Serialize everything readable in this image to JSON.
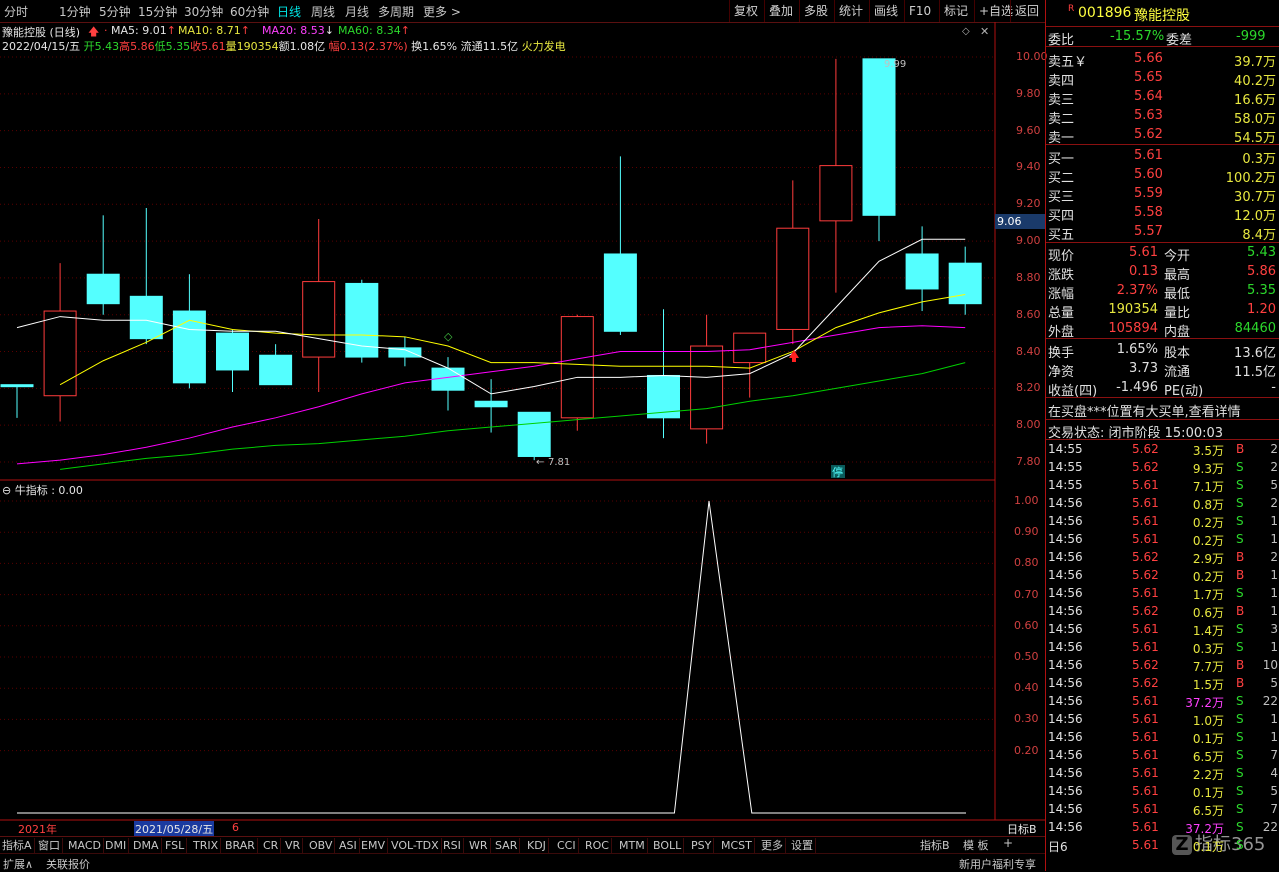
{
  "toolbar": {
    "tabs": [
      "分时",
      "1分钟",
      "5分钟",
      "15分钟",
      "30分钟",
      "60分钟",
      "日线",
      "周线",
      "月线",
      "多周期",
      "更多 >"
    ],
    "active": "日线",
    "right_buttons": [
      "复权",
      "叠加",
      "多股",
      "统计",
      "画线",
      "F10",
      "标记",
      "+自选",
      "返回"
    ]
  },
  "chart_title": {
    "name": "豫能控股 (日线)",
    "ma5": "MA5: 9.01",
    "ma10": "MA10: 8.71",
    "ma20": "MA20: 8.53",
    "ma60": "MA60: 8.34",
    "date": "2022/04/15/五",
    "open": "开5.43",
    "high": "高5.86",
    "low": "低5.35",
    "close": "收5.61",
    "vol": "量190354",
    "amt": "额1.08亿",
    "chg": "幅0.13(2.37%)",
    "turnover": "换1.65%",
    "float": "流通11.5亿",
    "concept": "火力发电"
  },
  "price_axis": [
    "10.00",
    "9.80",
    "9.60",
    "9.40",
    "9.20",
    "9.00",
    "8.80",
    "8.60",
    "8.40",
    "8.20",
    "8.00",
    "7.80"
  ],
  "price_marker": "9.06",
  "chart_labels": {
    "high_note": "9.99",
    "low_note": "7.81",
    "stop_badge": "停"
  },
  "chart_data": [
    {
      "type": "candlestick",
      "ylim": [
        7.72,
        10.1
      ],
      "candles": [
        {
          "o": 8.22,
          "c": 8.22,
          "h": 8.22,
          "l": 8.04
        },
        {
          "o": 8.16,
          "c": 8.62,
          "h": 8.88,
          "l": 8.02
        },
        {
          "o": 8.82,
          "c": 8.66,
          "h": 9.14,
          "l": 8.6
        },
        {
          "o": 8.7,
          "c": 8.47,
          "h": 9.18,
          "l": 8.44
        },
        {
          "o": 8.62,
          "c": 8.23,
          "h": 8.82,
          "l": 8.2
        },
        {
          "o": 8.5,
          "c": 8.3,
          "h": 8.52,
          "l": 8.18
        },
        {
          "o": 8.38,
          "c": 8.22,
          "h": 8.44,
          "l": 8.22
        },
        {
          "o": 8.37,
          "c": 8.78,
          "h": 9.12,
          "l": 8.18
        },
        {
          "o": 8.77,
          "c": 8.37,
          "h": 8.79,
          "l": 8.34
        },
        {
          "o": 8.42,
          "c": 8.37,
          "h": 8.48,
          "l": 8.32
        },
        {
          "o": 8.31,
          "c": 8.19,
          "h": 8.37,
          "l": 8.08
        },
        {
          "o": 8.13,
          "c": 8.1,
          "h": 8.25,
          "l": 7.96
        },
        {
          "o": 8.07,
          "c": 7.83,
          "h": 8.07,
          "l": 7.81
        },
        {
          "o": 8.04,
          "c": 8.59,
          "h": 8.6,
          "l": 7.97
        },
        {
          "o": 8.93,
          "c": 8.51,
          "h": 9.46,
          "l": 8.49
        },
        {
          "o": 8.27,
          "c": 8.04,
          "h": 8.63,
          "l": 7.93
        },
        {
          "o": 7.98,
          "c": 8.43,
          "h": 8.6,
          "l": 7.9
        },
        {
          "o": 8.34,
          "c": 8.5,
          "h": 8.5,
          "l": 8.15
        },
        {
          "o": 8.52,
          "c": 9.07,
          "h": 9.33,
          "l": 8.44
        },
        {
          "o": 9.11,
          "c": 9.41,
          "h": 9.99,
          "l": 8.72
        },
        {
          "o": 9.99,
          "c": 9.14,
          "h": 9.99,
          "l": 9.0
        },
        {
          "o": 8.93,
          "c": 8.74,
          "h": 9.08,
          "l": 8.62
        },
        {
          "o": 8.88,
          "c": 8.66,
          "h": 8.97,
          "l": 8.6
        }
      ],
      "ma5": [
        8.53,
        8.59,
        8.57,
        8.57,
        8.52,
        8.51,
        8.51,
        8.47,
        8.43,
        8.41,
        8.31,
        8.17,
        8.21,
        8.26,
        8.26,
        8.27,
        8.26,
        8.28,
        8.39,
        8.64,
        8.89,
        9.01,
        9.01
      ],
      "ma10": [
        null,
        8.22,
        8.35,
        8.45,
        8.57,
        8.52,
        8.5,
        8.49,
        8.49,
        8.48,
        8.43,
        8.34,
        8.34,
        8.33,
        8.32,
        8.32,
        8.32,
        8.31,
        8.4,
        8.53,
        8.61,
        8.67,
        8.71
      ],
      "ma20": [
        7.79,
        7.81,
        7.84,
        7.88,
        7.93,
        7.99,
        8.04,
        8.1,
        8.17,
        8.23,
        8.26,
        8.29,
        8.32,
        8.36,
        8.4,
        8.4,
        8.4,
        8.41,
        8.45,
        8.49,
        8.53,
        8.54,
        8.53
      ],
      "ma60": [
        null,
        7.76,
        7.79,
        7.82,
        7.84,
        7.87,
        7.89,
        7.9,
        7.92,
        7.94,
        7.97,
        7.99,
        8.01,
        8.03,
        8.05,
        8.07,
        8.09,
        8.13,
        8.16,
        8.2,
        8.24,
        8.28,
        8.34
      ]
    },
    {
      "type": "line",
      "title": "牛指标 : 0.00",
      "ylim": [
        0,
        1.0
      ],
      "values": [
        0,
        0,
        0,
        0,
        0,
        0,
        0,
        0,
        0,
        0,
        0,
        0,
        0,
        0,
        0,
        0,
        0,
        0,
        0,
        0,
        1,
        0,
        0,
        0,
        0,
        0,
        0
      ]
    }
  ],
  "sub_title": "牛指标 : 0.00",
  "sub_axis": [
    "1.00",
    "0.90",
    "0.80",
    "0.70",
    "0.60",
    "0.50",
    "0.40",
    "0.30",
    "0.20"
  ],
  "sub_right_label": "日标B",
  "time_axis": {
    "year": "2021年",
    "cursor_date": "2021/05/28/五",
    "six": "6"
  },
  "indicator_tabs": [
    "指标A",
    "窗口",
    "MACD",
    "DMI",
    "DMA",
    "FSL",
    "TRIX",
    "BRAR",
    "CR",
    "VR",
    "OBV",
    "ASI",
    "EMV",
    "VOL-TDX",
    "RSI",
    "WR",
    "SAR",
    "KDJ",
    "CCI",
    "ROC",
    "MTM",
    "BOLL",
    "PSY",
    "MCST",
    "更多",
    "设置"
  ],
  "indicator_right": [
    "指标B",
    "模 板",
    "+"
  ],
  "status_left": [
    "扩展∧",
    "关联报价"
  ],
  "status_right": "新用户福利专享",
  "quote": {
    "badge": "R",
    "code": "001896",
    "name": "豫能控股",
    "webi_label": "委比",
    "webi": "-15.57%",
    "weicha_label": "委差",
    "weicha": "-999",
    "asks": [
      {
        "label": "卖五￥",
        "price": "5.66",
        "vol": "39.7万"
      },
      {
        "label": "卖四",
        "price": "5.65",
        "vol": "40.2万"
      },
      {
        "label": "卖三",
        "price": "5.64",
        "vol": "16.6万"
      },
      {
        "label": "卖二",
        "price": "5.63",
        "vol": "58.0万"
      },
      {
        "label": "卖一",
        "price": "5.62",
        "vol": "54.5万"
      }
    ],
    "bids": [
      {
        "label": "买一",
        "price": "5.61",
        "vol": "0.3万"
      },
      {
        "label": "买二",
        "price": "5.60",
        "vol": "100.2万"
      },
      {
        "label": "买三",
        "price": "5.59",
        "vol": "30.7万"
      },
      {
        "label": "买四",
        "price": "5.58",
        "vol": "12.0万"
      },
      {
        "label": "买五",
        "price": "5.57",
        "vol": "8.4万"
      }
    ],
    "stats": [
      {
        "l1": "现价",
        "v1": "5.61",
        "c1": "red",
        "l2": "今开",
        "v2": "5.43",
        "c2": "green"
      },
      {
        "l1": "涨跌",
        "v1": "0.13",
        "c1": "red",
        "l2": "最高",
        "v2": "5.86",
        "c2": "red"
      },
      {
        "l1": "涨幅",
        "v1": "2.37%",
        "c1": "red",
        "l2": "最低",
        "v2": "5.35",
        "c2": "green"
      },
      {
        "l1": "总量",
        "v1": "190354",
        "c1": "yellow",
        "l2": "量比",
        "v2": "1.20",
        "c2": "red"
      },
      {
        "l1": "外盘",
        "v1": "105894",
        "c1": "red",
        "l2": "内盘",
        "v2": "84460",
        "c2": "green"
      }
    ],
    "fund": [
      {
        "l1": "换手",
        "v1": "1.65%",
        "l2": "股本",
        "v2": "13.6亿"
      },
      {
        "l1": "净资",
        "v1": "3.73",
        "l2": "流通",
        "v2": "11.5亿"
      },
      {
        "l1": "收益(四)",
        "v1": "-1.496",
        "l2": "PE(动)",
        "v2": "-"
      }
    ],
    "notice": "在买盘***位置有大买单,查看详情",
    "trade_status": "交易状态: 闭市阶段 15:00:03",
    "ticks": [
      {
        "t": "14:55",
        "p": "5.62",
        "v": "3.5万",
        "d": "B",
        "n": "2"
      },
      {
        "t": "14:55",
        "p": "5.62",
        "v": "9.3万",
        "d": "S",
        "n": "2"
      },
      {
        "t": "14:55",
        "p": "5.61",
        "v": "7.1万",
        "d": "S",
        "n": "5"
      },
      {
        "t": "14:56",
        "p": "5.61",
        "v": "0.8万",
        "d": "S",
        "n": "2"
      },
      {
        "t": "14:56",
        "p": "5.61",
        "v": "0.2万",
        "d": "S",
        "n": "1"
      },
      {
        "t": "14:56",
        "p": "5.61",
        "v": "0.2万",
        "d": "S",
        "n": "1"
      },
      {
        "t": "14:56",
        "p": "5.62",
        "v": "2.9万",
        "d": "B",
        "n": "2"
      },
      {
        "t": "14:56",
        "p": "5.62",
        "v": "0.2万",
        "d": "B",
        "n": "1"
      },
      {
        "t": "14:56",
        "p": "5.61",
        "v": "1.7万",
        "d": "S",
        "n": "1"
      },
      {
        "t": "14:56",
        "p": "5.62",
        "v": "0.6万",
        "d": "B",
        "n": "1"
      },
      {
        "t": "14:56",
        "p": "5.61",
        "v": "1.4万",
        "d": "S",
        "n": "3"
      },
      {
        "t": "14:56",
        "p": "5.61",
        "v": "0.3万",
        "d": "S",
        "n": "1"
      },
      {
        "t": "14:56",
        "p": "5.62",
        "v": "7.7万",
        "d": "B",
        "n": "10"
      },
      {
        "t": "14:56",
        "p": "5.62",
        "v": "1.5万",
        "d": "B",
        "n": "5"
      },
      {
        "t": "14:56",
        "p": "5.61",
        "v": "37.2万",
        "d": "S",
        "n": "22"
      },
      {
        "t": "14:56",
        "p": "5.61",
        "v": "1.0万",
        "d": "S",
        "n": "1"
      },
      {
        "t": "14:56",
        "p": "5.61",
        "v": "0.1万",
        "d": "S",
        "n": "1"
      },
      {
        "t": "14:56",
        "p": "5.61",
        "v": "6.5万",
        "d": "S",
        "n": "7"
      },
      {
        "t": "14:56",
        "p": "5.61",
        "v": "2.2万",
        "d": "S",
        "n": "4"
      },
      {
        "t": "14:56",
        "p": "5.61",
        "v": "0.1万",
        "d": "S",
        "n": "5"
      },
      {
        "t": "14:56",
        "p": "5.61",
        "v": "6.5万",
        "d": "S",
        "n": "7"
      },
      {
        "t": "14:56",
        "p": "5.61",
        "v": "37.2万",
        "d": "S",
        "n": "22"
      },
      {
        "t": "日6",
        "p": "5.61",
        "v": "0.1万",
        "d": "S",
        "n": ""
      }
    ],
    "watermark": "指标365"
  },
  "colors": {
    "up": "#ff3c3c",
    "down": "#54ffff",
    "ma5": "#ffffff",
    "ma10": "#ffff00",
    "ma20": "#ff00ff",
    "ma60": "#00d000",
    "grid": "#5a0000"
  }
}
